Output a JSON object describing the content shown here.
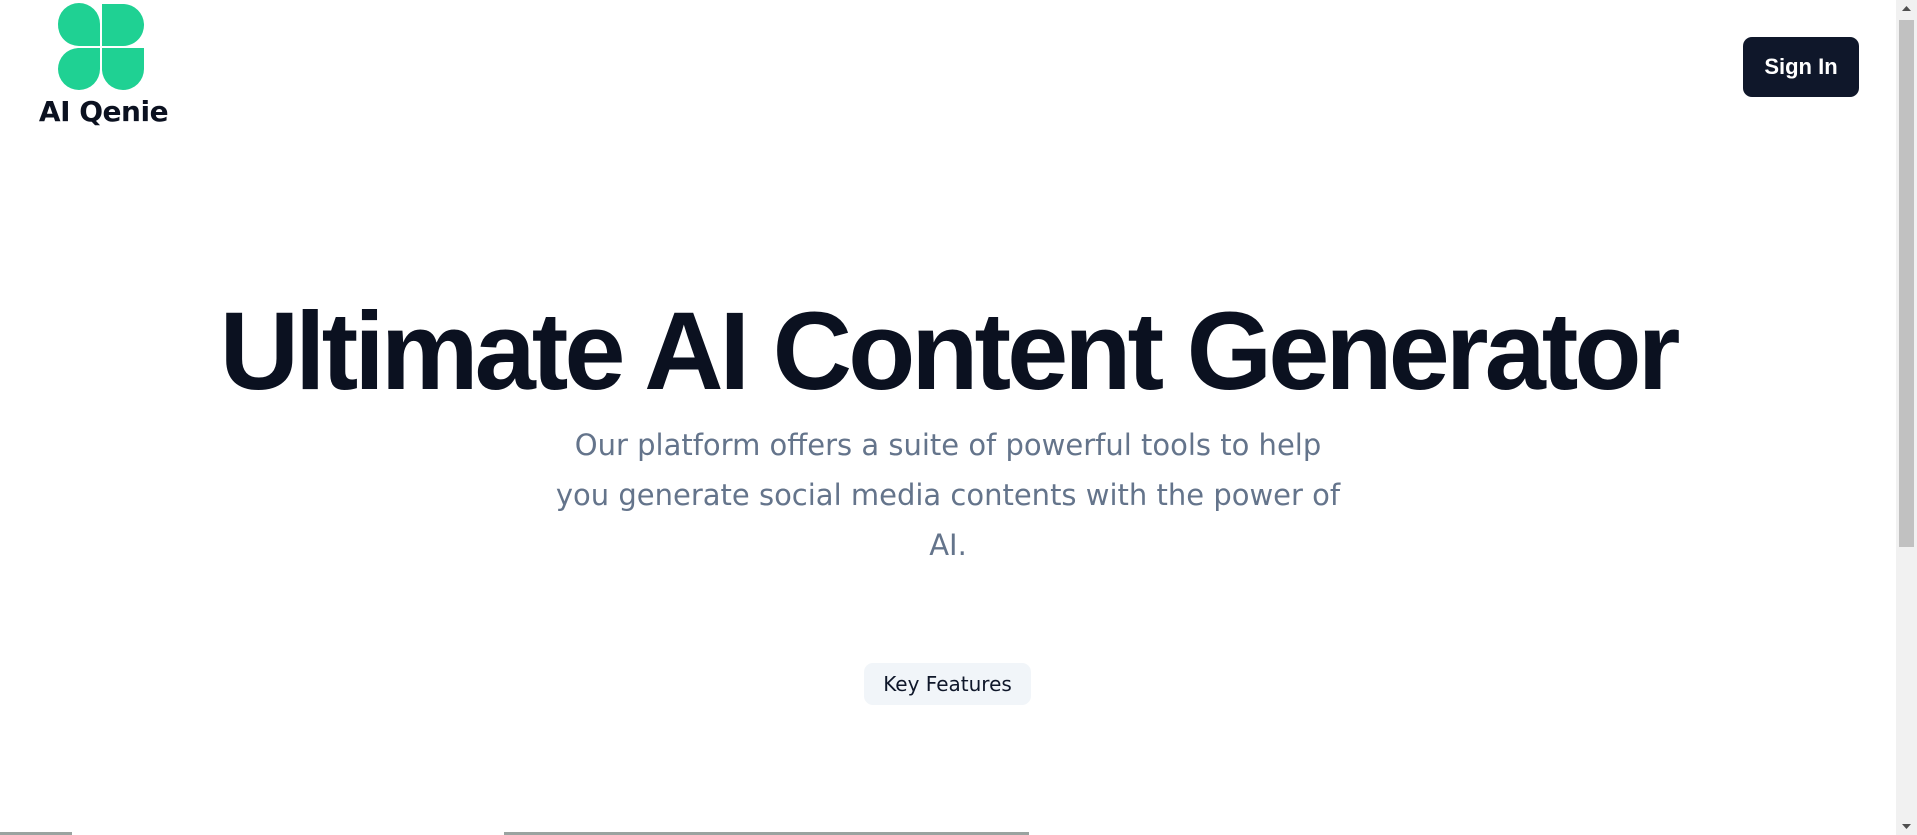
{
  "brand": {
    "name": "AI Qenie",
    "logo_color": "#1fd193"
  },
  "header": {
    "sign_in_label": "Sign In"
  },
  "hero": {
    "title": "Ultimate AI Content Generator",
    "subtitle": "Our platform offers a suite of powerful tools to help you generate social media contents with the power of AI."
  },
  "features": {
    "badge_label": "Key Features"
  },
  "colors": {
    "primary_dark": "#0f172a",
    "heading": "#0b1120",
    "muted_text": "#64748b",
    "badge_bg": "#f1f5f9",
    "accent_green": "#1fd193"
  },
  "icons": {
    "logo": "four-leaf-logo-icon",
    "scroll_up": "scroll-up-arrow-icon",
    "scroll_down": "scroll-down-arrow-icon"
  }
}
